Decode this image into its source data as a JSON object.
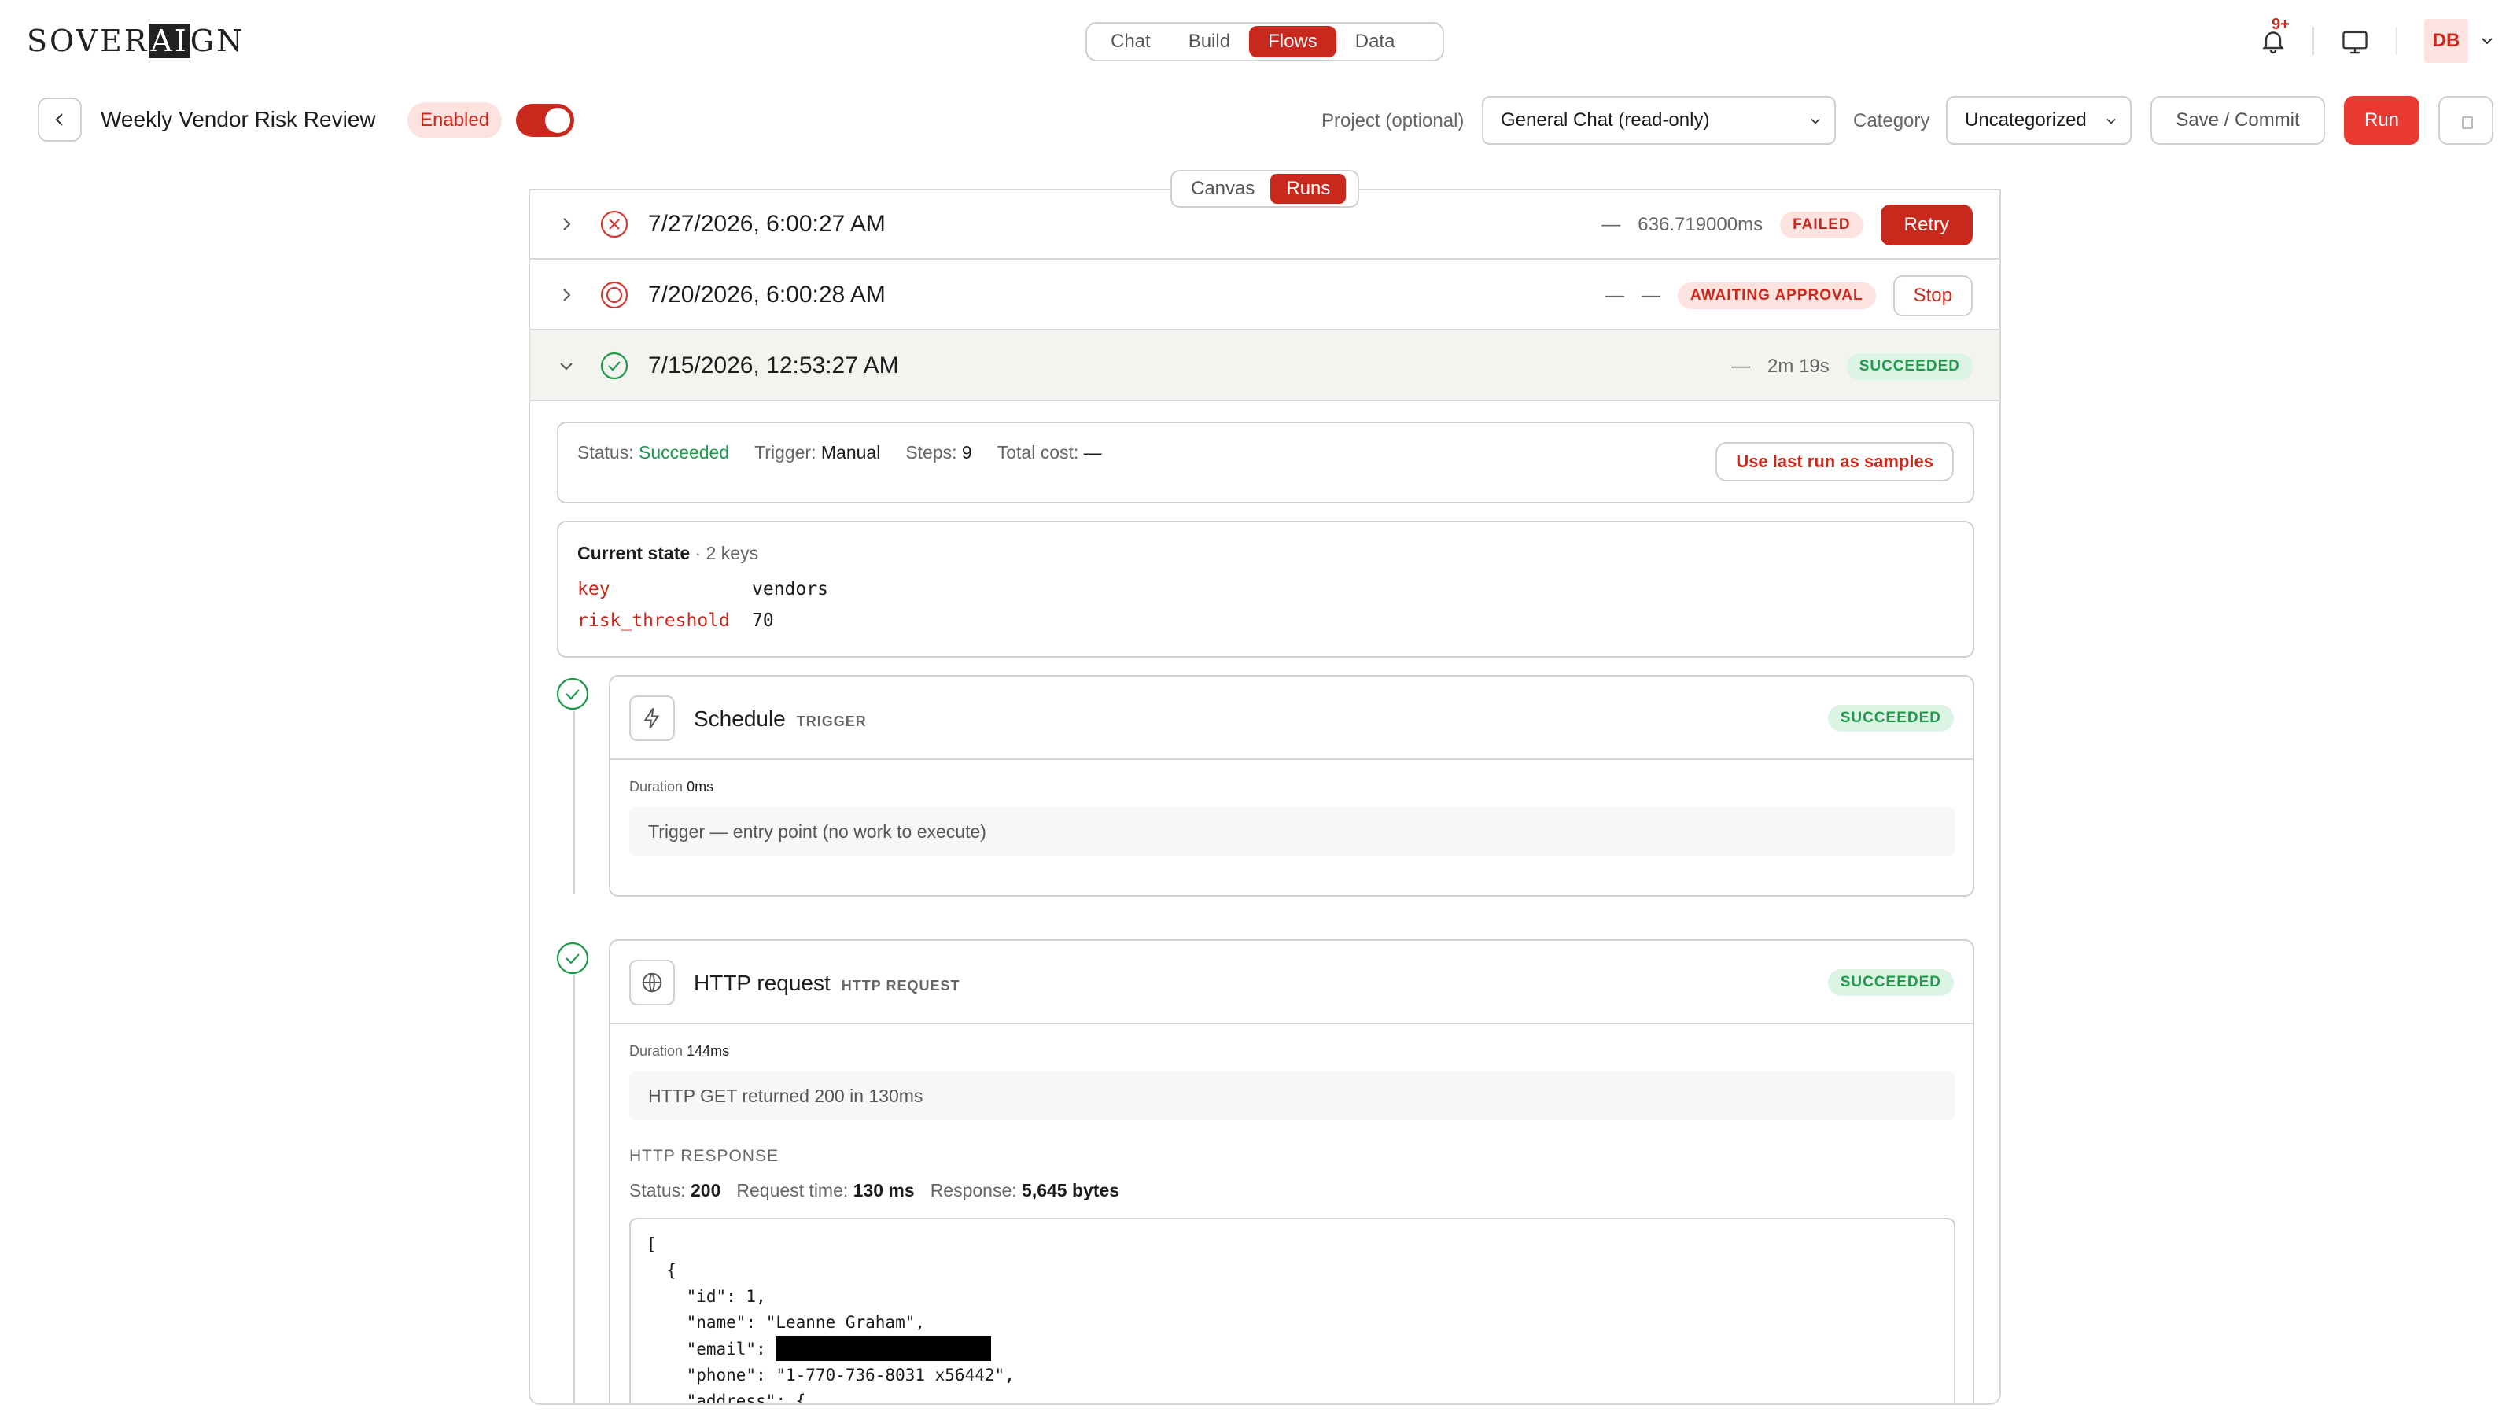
{
  "app": {
    "logo_text_a": "SOVER",
    "logo_text_b": "AI",
    "logo_text_c": "GN",
    "nav_tabs": [
      "Chat",
      "Build",
      "Flows",
      "Data"
    ],
    "active_tab": "Flows",
    "notification_count": "9+",
    "user_initials": "DB"
  },
  "flow": {
    "title": "Weekly Vendor Risk Review",
    "status_badge": "Enabled",
    "enabled": true,
    "project_label": "Project (optional)",
    "project_value": "General Chat (read-only)",
    "category_label": "Category",
    "category_value": "Uncategorized",
    "save_label": "Save / Commit",
    "run_label": "Run"
  },
  "view_tabs": [
    "Canvas",
    "Runs"
  ],
  "active_view": "Runs",
  "runs": [
    {
      "date": "7/27/2026, 6:00:27 AM",
      "col1": "—",
      "duration": "636.719000ms",
      "status": "FAILED",
      "action": "Retry"
    },
    {
      "date": "7/20/2026, 6:00:28 AM",
      "col1": "—",
      "duration": "—",
      "status": "AWAITING APPROVAL",
      "action": "Stop"
    },
    {
      "date": "7/15/2026, 12:53:27 AM",
      "col1": "—",
      "duration": "2m 19s",
      "status": "SUCCEEDED"
    }
  ],
  "run_detail": {
    "status_label": "Status:",
    "status_value": "Succeeded",
    "trigger_label": "Trigger:",
    "trigger_value": "Manual",
    "steps_label": "Steps:",
    "steps_value": "9",
    "cost_label": "Total cost:",
    "cost_value": "—",
    "samples_button": "Use last run as samples",
    "state_title": "Current state",
    "state_count": "· 2 keys",
    "state": [
      {
        "key": "key",
        "value": "vendors"
      },
      {
        "key": "risk_threshold",
        "value": "70"
      }
    ]
  },
  "steps": [
    {
      "name": "Schedule",
      "kind": "TRIGGER",
      "status": "SUCCEEDED",
      "duration_label": "Duration",
      "duration": "0ms",
      "note": "Trigger — entry point (no work to execute)"
    },
    {
      "name": "HTTP request",
      "kind": "HTTP REQUEST",
      "status": "SUCCEEDED",
      "duration_label": "Duration",
      "duration": "144ms",
      "note": "HTTP GET returned 200 in 130ms",
      "response_title": "HTTP RESPONSE",
      "resp_status_label": "Status:",
      "resp_status": "200",
      "resp_time_label": "Request time:",
      "resp_time": "130 ms",
      "resp_size_label": "Response:",
      "resp_size": "5,645 bytes",
      "code_lines": [
        "[",
        "  {",
        "    \"id\": 1,",
        "    \"name\": \"Leanne Graham\",",
        "    \"email\": ",
        "    \"phone\": \"1-770-736-8031 x56442\",",
        "    \"address\": {"
      ]
    }
  ],
  "colors": {
    "accent": "#c8291c",
    "run_button": "#ea3a32",
    "success": "#1f9a4b",
    "danger_bg": "#fde3df",
    "success_bg": "#dcf4e3"
  }
}
